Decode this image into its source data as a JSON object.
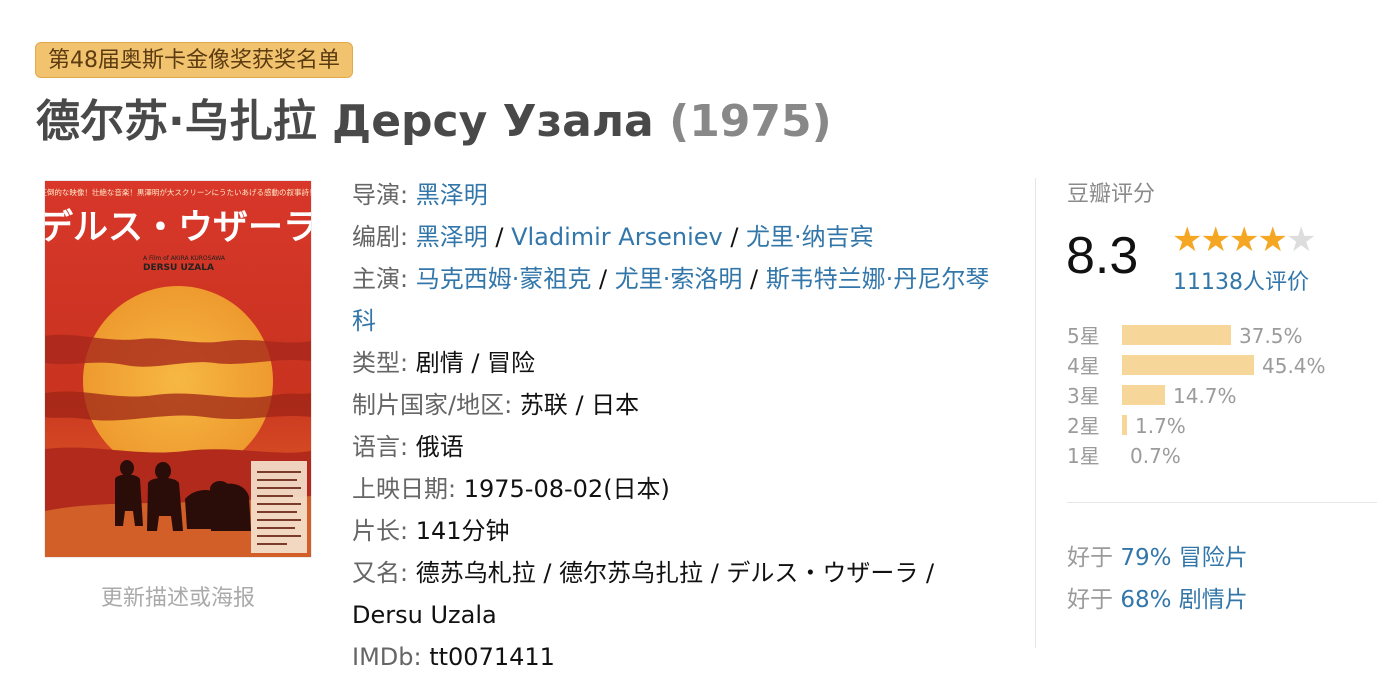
{
  "award_badge": "第48届奥斯卡金像奖获奖名单",
  "title": {
    "main": "德尔苏·乌扎拉 Дерсу Узала",
    "year": "(1975)"
  },
  "poster": {
    "headline_jp": "デルス・ウザーラ",
    "subtitle": "DERSU UZALA",
    "credit": "A Film of AKIRA KUROSAWA",
    "tagline_jp": "圧倒的な映像！壮絶な音楽！黒澤明が大スクリーンにうたいあげる感動の叙事詩！"
  },
  "update_link": "更新描述或海报",
  "info": {
    "director": {
      "label": "导演",
      "values": [
        "黑泽明"
      ]
    },
    "writers": {
      "label": "编剧",
      "values": [
        "黑泽明",
        "Vladimir Arseniev",
        "尤里·纳吉宾"
      ]
    },
    "cast": {
      "label": "主演",
      "values": [
        "马克西姆·蒙祖克",
        "尤里·索洛明",
        "斯韦特兰娜·丹尼尔琴科"
      ]
    },
    "genre": {
      "label": "类型",
      "value": "剧情 / 冒险"
    },
    "country": {
      "label": "制片国家/地区",
      "value": "苏联 / 日本"
    },
    "language": {
      "label": "语言",
      "value": "俄语"
    },
    "release": {
      "label": "上映日期",
      "value": "1975-08-02(日本)"
    },
    "runtime": {
      "label": "片长",
      "value": "141分钟"
    },
    "aka": {
      "label": "又名",
      "value": "德苏乌札拉 / 德尔苏乌扎拉 / デルス・ウザーラ / Dersu Uzala"
    },
    "imdb": {
      "label": "IMDb",
      "value": "tt0071411"
    }
  },
  "rating": {
    "label": "豆瓣评分",
    "score": "8.3",
    "stars": 4,
    "votes": "11138人评价",
    "distribution": [
      {
        "label": "5星",
        "percent": 37.5,
        "text": "37.5%"
      },
      {
        "label": "4星",
        "percent": 45.4,
        "text": "45.4%"
      },
      {
        "label": "3星",
        "percent": 14.7,
        "text": "14.7%"
      },
      {
        "label": "2星",
        "percent": 1.7,
        "text": "1.7%"
      },
      {
        "label": "1星",
        "percent": 0.7,
        "text": "0.7%"
      }
    ],
    "better_than": [
      {
        "prefix": "好于",
        "percent": "79%",
        "genre": "冒险片"
      },
      {
        "prefix": "好于",
        "percent": "68%",
        "genre": "剧情片"
      }
    ]
  },
  "colors": {
    "link": "#3377aa",
    "badge_bg": "#f2c36f",
    "star": "#f5a623",
    "bar": "#f7d69a",
    "poster_red": "#d9382b",
    "poster_sun": "#f0a83a"
  }
}
